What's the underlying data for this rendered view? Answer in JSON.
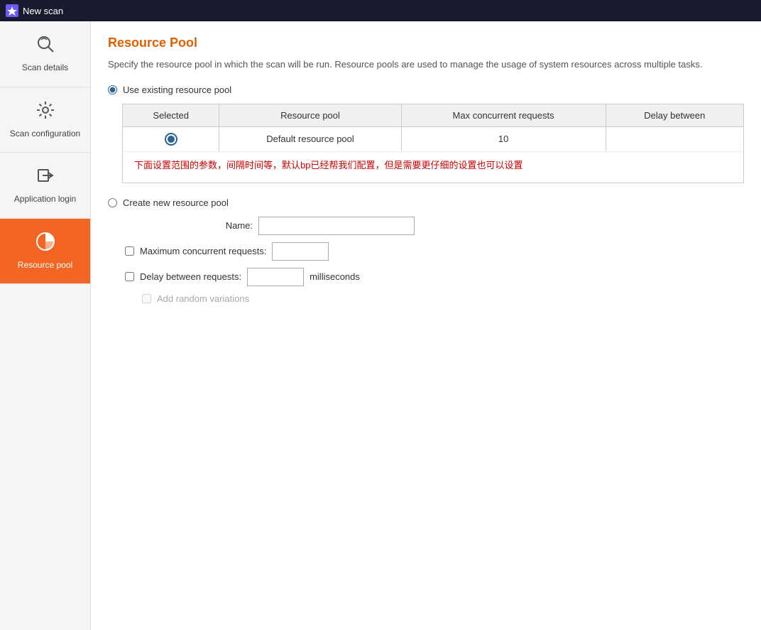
{
  "topbar": {
    "title": "New scan",
    "icon": "⚡"
  },
  "sidebar": {
    "items": [
      {
        "id": "scan-details",
        "label": "Scan details",
        "icon": "scan",
        "active": false
      },
      {
        "id": "scan-configuration",
        "label": "Scan configuration",
        "icon": "gear",
        "active": false
      },
      {
        "id": "application-login",
        "label": "Application login",
        "icon": "login",
        "active": false
      },
      {
        "id": "resource-pool",
        "label": "Resource pool",
        "icon": "pie",
        "active": true
      }
    ]
  },
  "content": {
    "title": "Resource Pool",
    "description": "Specify the resource pool in which the scan will be run. Resource pools are used to manage the usage of system resources across multiple tasks.",
    "use_existing_label": "Use existing resource pool",
    "create_new_label": "Create new resource pool",
    "table": {
      "columns": [
        "Selected",
        "Resource pool",
        "Max concurrent requests",
        "Delay between"
      ],
      "rows": [
        {
          "selected": true,
          "resource_pool": "Default resource pool",
          "max_concurrent": "10",
          "delay_between": ""
        }
      ]
    },
    "note_chinese": "下面设置范围的参数，间隔时间等，默认bp已经帮我们配置，但是需要更仔细的设置也可以设置",
    "form": {
      "name_label": "Name:",
      "name_placeholder": "",
      "max_concurrent_label": "Maximum concurrent requests:",
      "delay_label": "Delay between requests:",
      "milliseconds_label": "milliseconds",
      "add_random_label": "Add random variations"
    }
  }
}
